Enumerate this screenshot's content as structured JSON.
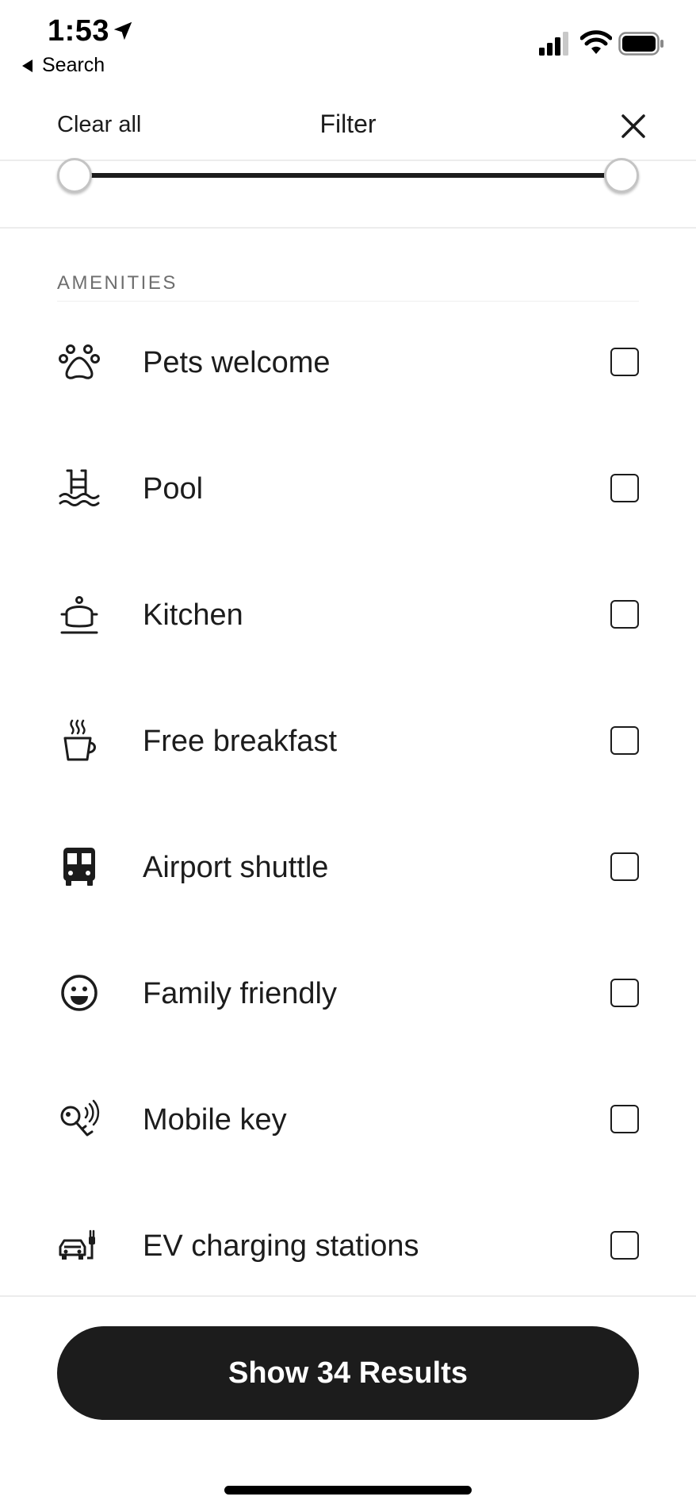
{
  "status_bar": {
    "time": "1:53",
    "back_label": "Search"
  },
  "header": {
    "clear_label": "Clear all",
    "title": "Filter"
  },
  "amenities": {
    "section_label": "AMENITIES",
    "items": [
      {
        "label": "Pets welcome",
        "icon": "paw-icon",
        "checked": false
      },
      {
        "label": "Pool",
        "icon": "pool-icon",
        "checked": false
      },
      {
        "label": "Kitchen",
        "icon": "cooking-pot-icon",
        "checked": false
      },
      {
        "label": "Free breakfast",
        "icon": "coffee-cup-icon",
        "checked": false
      },
      {
        "label": "Airport shuttle",
        "icon": "bus-icon",
        "checked": false
      },
      {
        "label": "Family friendly",
        "icon": "smiley-icon",
        "checked": false
      },
      {
        "label": "Mobile key",
        "icon": "mobile-key-icon",
        "checked": false
      },
      {
        "label": "EV charging stations",
        "icon": "ev-charging-icon",
        "checked": false
      }
    ]
  },
  "footer": {
    "results_button": "Show 34 Results"
  },
  "colors": {
    "primary": "#1c1c1c",
    "muted": "#6e6e6e",
    "divider": "#ececec"
  }
}
